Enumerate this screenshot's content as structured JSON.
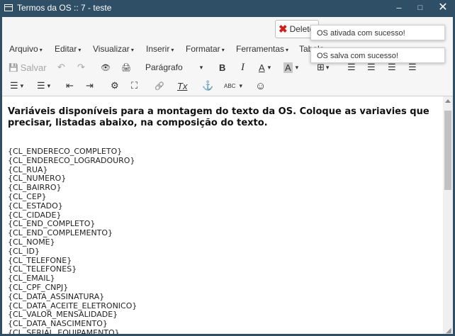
{
  "window": {
    "title": "Termos da OS :: 7 - teste",
    "min": "–",
    "max": "□",
    "close": "✕"
  },
  "topbar": {
    "delete_label": "Delete"
  },
  "menu": [
    {
      "label": "Arquivo"
    },
    {
      "label": "Editar"
    },
    {
      "label": "Visualizar"
    },
    {
      "label": "Inserir"
    },
    {
      "label": "Formatar"
    },
    {
      "label": "Ferramentas"
    },
    {
      "label": "Tabela"
    }
  ],
  "toolbar": {
    "save_label": "Salvar",
    "paragraph_label": "Parágrafo"
  },
  "icons": {
    "save": "💾",
    "undo": "↶",
    "redo": "↷",
    "preview": "👁",
    "print": "🖨",
    "bold": "B",
    "italic": "I",
    "fontcolor": "A",
    "bgcolor": "A",
    "table": "⊞",
    "bullets": "☰",
    "numbers": "☰",
    "outdent": "⇤",
    "indent": "⇥",
    "settings": "⚙",
    "fullscreen": "⛶",
    "link": "🔗",
    "clear": "Tx",
    "binoculars": "⚓",
    "spell": "ABC",
    "emoji": "☺",
    "caret": "▾"
  },
  "editor": {
    "heading": "Variáveis disponíveis para a montagem do texto da OS.  Coloque as variavies que precisar, listadas abaixo, na composição do texto.",
    "variables": [
      "{CL_ENDERECO_COMPLETO}",
      "{CL_ENDERECO_LOGRADOURO}",
      "{CL_RUA}",
      "{CL_NUMERO}",
      "{CL_BAIRRO}",
      "{CL_CEP}",
      "{CL_ESTADO}",
      "{CL_CIDADE}",
      "{CL_END_COMPLETO}",
      "{CL_END_COMPLEMENTO}",
      "{CL_NOME}",
      "{CL_ID}",
      "{CL_TELEFONE}",
      "{CL_TELEFONES}",
      "{CL_EMAIL}",
      "{CL_CPF_CNPJ}",
      "{CL_DATA_ASSINATURA}",
      "{CL_DATA_ACEITE_ELETRONICO}",
      "{CL_VALOR_MENSALIDADE}",
      "{CL_DATA_NASCIMENTO}",
      "{CL_SERIAL_EQUIPAMENTO}"
    ]
  },
  "toasts": [
    {
      "text": "OS ativada com sucesso!"
    },
    {
      "text": "OS salva com sucesso!"
    }
  ]
}
